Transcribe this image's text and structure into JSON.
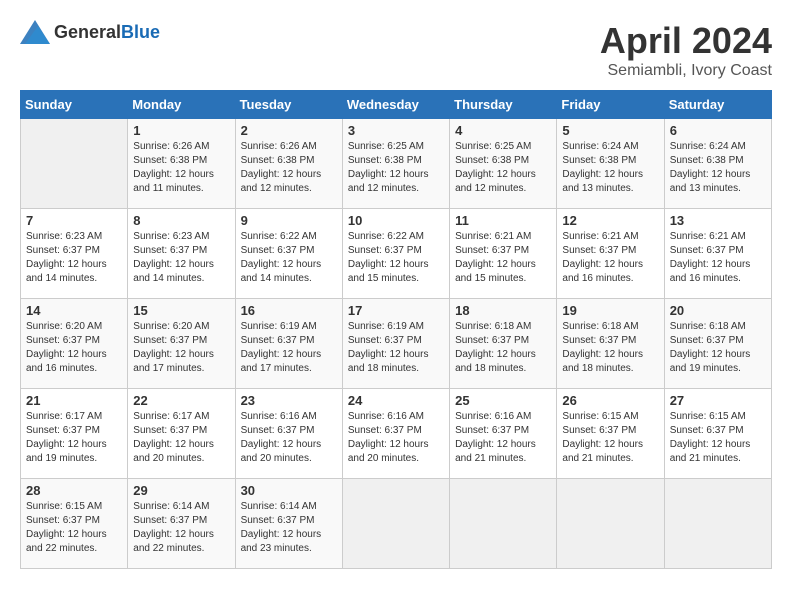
{
  "header": {
    "logo_general": "General",
    "logo_blue": "Blue",
    "month": "April 2024",
    "location": "Semiambli, Ivory Coast"
  },
  "days_of_week": [
    "Sunday",
    "Monday",
    "Tuesday",
    "Wednesday",
    "Thursday",
    "Friday",
    "Saturday"
  ],
  "weeks": [
    [
      {
        "day": "",
        "info": ""
      },
      {
        "day": "1",
        "info": "Sunrise: 6:26 AM\nSunset: 6:38 PM\nDaylight: 12 hours\nand 11 minutes."
      },
      {
        "day": "2",
        "info": "Sunrise: 6:26 AM\nSunset: 6:38 PM\nDaylight: 12 hours\nand 12 minutes."
      },
      {
        "day": "3",
        "info": "Sunrise: 6:25 AM\nSunset: 6:38 PM\nDaylight: 12 hours\nand 12 minutes."
      },
      {
        "day": "4",
        "info": "Sunrise: 6:25 AM\nSunset: 6:38 PM\nDaylight: 12 hours\nand 12 minutes."
      },
      {
        "day": "5",
        "info": "Sunrise: 6:24 AM\nSunset: 6:38 PM\nDaylight: 12 hours\nand 13 minutes."
      },
      {
        "day": "6",
        "info": "Sunrise: 6:24 AM\nSunset: 6:38 PM\nDaylight: 12 hours\nand 13 minutes."
      }
    ],
    [
      {
        "day": "7",
        "info": "Sunrise: 6:23 AM\nSunset: 6:37 PM\nDaylight: 12 hours\nand 14 minutes."
      },
      {
        "day": "8",
        "info": "Sunrise: 6:23 AM\nSunset: 6:37 PM\nDaylight: 12 hours\nand 14 minutes."
      },
      {
        "day": "9",
        "info": "Sunrise: 6:22 AM\nSunset: 6:37 PM\nDaylight: 12 hours\nand 14 minutes."
      },
      {
        "day": "10",
        "info": "Sunrise: 6:22 AM\nSunset: 6:37 PM\nDaylight: 12 hours\nand 15 minutes."
      },
      {
        "day": "11",
        "info": "Sunrise: 6:21 AM\nSunset: 6:37 PM\nDaylight: 12 hours\nand 15 minutes."
      },
      {
        "day": "12",
        "info": "Sunrise: 6:21 AM\nSunset: 6:37 PM\nDaylight: 12 hours\nand 16 minutes."
      },
      {
        "day": "13",
        "info": "Sunrise: 6:21 AM\nSunset: 6:37 PM\nDaylight: 12 hours\nand 16 minutes."
      }
    ],
    [
      {
        "day": "14",
        "info": "Sunrise: 6:20 AM\nSunset: 6:37 PM\nDaylight: 12 hours\nand 16 minutes."
      },
      {
        "day": "15",
        "info": "Sunrise: 6:20 AM\nSunset: 6:37 PM\nDaylight: 12 hours\nand 17 minutes."
      },
      {
        "day": "16",
        "info": "Sunrise: 6:19 AM\nSunset: 6:37 PM\nDaylight: 12 hours\nand 17 minutes."
      },
      {
        "day": "17",
        "info": "Sunrise: 6:19 AM\nSunset: 6:37 PM\nDaylight: 12 hours\nand 18 minutes."
      },
      {
        "day": "18",
        "info": "Sunrise: 6:18 AM\nSunset: 6:37 PM\nDaylight: 12 hours\nand 18 minutes."
      },
      {
        "day": "19",
        "info": "Sunrise: 6:18 AM\nSunset: 6:37 PM\nDaylight: 12 hours\nand 18 minutes."
      },
      {
        "day": "20",
        "info": "Sunrise: 6:18 AM\nSunset: 6:37 PM\nDaylight: 12 hours\nand 19 minutes."
      }
    ],
    [
      {
        "day": "21",
        "info": "Sunrise: 6:17 AM\nSunset: 6:37 PM\nDaylight: 12 hours\nand 19 minutes."
      },
      {
        "day": "22",
        "info": "Sunrise: 6:17 AM\nSunset: 6:37 PM\nDaylight: 12 hours\nand 20 minutes."
      },
      {
        "day": "23",
        "info": "Sunrise: 6:16 AM\nSunset: 6:37 PM\nDaylight: 12 hours\nand 20 minutes."
      },
      {
        "day": "24",
        "info": "Sunrise: 6:16 AM\nSunset: 6:37 PM\nDaylight: 12 hours\nand 20 minutes."
      },
      {
        "day": "25",
        "info": "Sunrise: 6:16 AM\nSunset: 6:37 PM\nDaylight: 12 hours\nand 21 minutes."
      },
      {
        "day": "26",
        "info": "Sunrise: 6:15 AM\nSunset: 6:37 PM\nDaylight: 12 hours\nand 21 minutes."
      },
      {
        "day": "27",
        "info": "Sunrise: 6:15 AM\nSunset: 6:37 PM\nDaylight: 12 hours\nand 21 minutes."
      }
    ],
    [
      {
        "day": "28",
        "info": "Sunrise: 6:15 AM\nSunset: 6:37 PM\nDaylight: 12 hours\nand 22 minutes."
      },
      {
        "day": "29",
        "info": "Sunrise: 6:14 AM\nSunset: 6:37 PM\nDaylight: 12 hours\nand 22 minutes."
      },
      {
        "day": "30",
        "info": "Sunrise: 6:14 AM\nSunset: 6:37 PM\nDaylight: 12 hours\nand 23 minutes."
      },
      {
        "day": "",
        "info": ""
      },
      {
        "day": "",
        "info": ""
      },
      {
        "day": "",
        "info": ""
      },
      {
        "day": "",
        "info": ""
      }
    ]
  ]
}
